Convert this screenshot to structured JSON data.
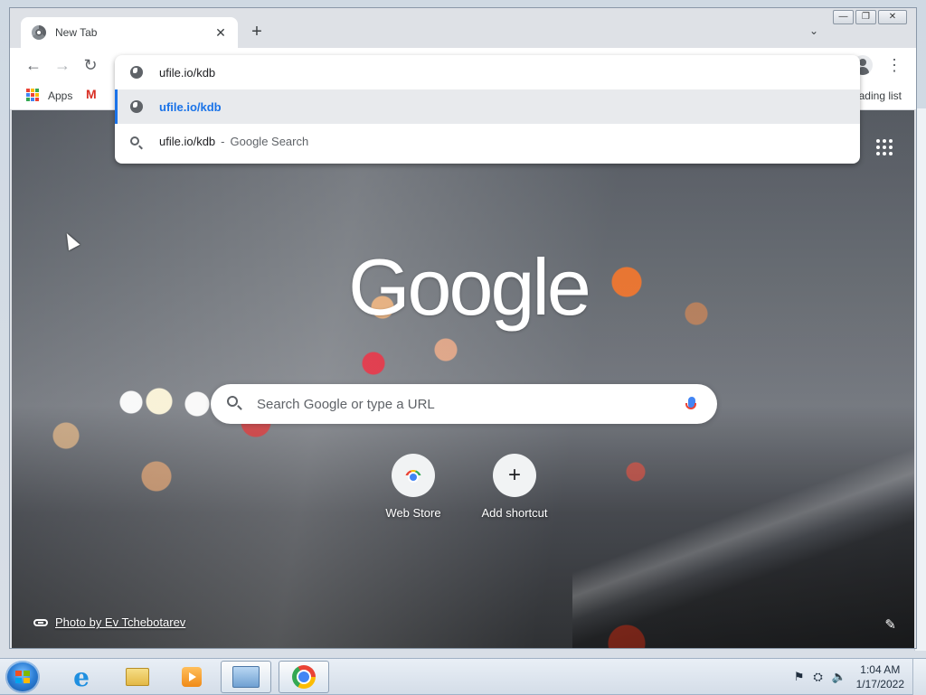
{
  "browser": {
    "tab": {
      "title": "New Tab",
      "close_glyph": "✕"
    },
    "newtab_glyph": "+",
    "tabsearch_glyph": "⌄",
    "window_controls": {
      "minimize": "—",
      "restore": "❐",
      "close": "✕"
    },
    "nav": {
      "back": "←",
      "forward": "→",
      "reload": "↻"
    },
    "menu_glyph": "⋮",
    "omnibox": {
      "input": "ufile.io/kdb",
      "suggestions": [
        {
          "type": "url",
          "text": "ufile.io/kdb",
          "selected": true
        },
        {
          "type": "search",
          "text": "ufile.io/kdb",
          "separator": "-",
          "description": "Google Search"
        }
      ]
    },
    "bookmarks": {
      "apps_label": "Apps",
      "gmail_glyph": "M",
      "reading_list": "Reading list"
    }
  },
  "ntp": {
    "logo": "Google",
    "search_placeholder": "Search Google or type a URL",
    "shortcuts": [
      {
        "label": "Web Store",
        "icon": "webstore-icon"
      },
      {
        "label": "Add shortcut",
        "icon": "plus-icon",
        "glyph": "+"
      }
    ],
    "attribution": "Photo by Ev Tchebotarev",
    "edit_glyph": "✎"
  },
  "taskbar": {
    "apps": [
      "internet-explorer",
      "file-explorer",
      "media-player",
      "remote-desktop",
      "chrome"
    ],
    "active": "chrome",
    "tray_glyphs": {
      "flag": "⚑",
      "network": "⛭",
      "volume": "🔈"
    },
    "clock": {
      "time": "1:04 AM",
      "date": "1/17/2022"
    }
  }
}
